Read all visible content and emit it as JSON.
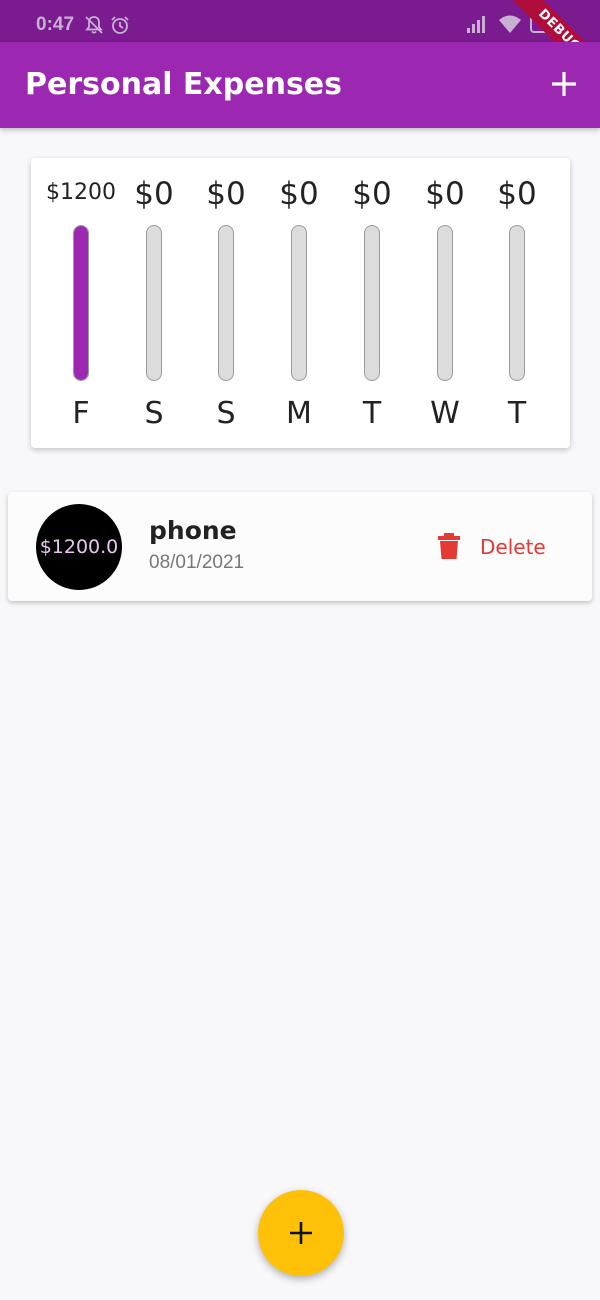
{
  "status_bar": {
    "time": "0:47",
    "icons": [
      "notifications-off-icon",
      "alarm-icon",
      "signal-icon",
      "wifi-icon",
      "battery-icon"
    ],
    "battery_level": "40"
  },
  "debug_banner": "DEBUG",
  "app_bar": {
    "title": "Personal Expenses",
    "action_icon": "add-icon",
    "background": "#9c27b0"
  },
  "chart": {
    "bars": [
      {
        "day": "F",
        "amount": "$1200",
        "fill_fraction": 1.0
      },
      {
        "day": "S",
        "amount": "$0",
        "fill_fraction": 0
      },
      {
        "day": "S",
        "amount": "$0",
        "fill_fraction": 0
      },
      {
        "day": "M",
        "amount": "$0",
        "fill_fraction": 0
      },
      {
        "day": "T",
        "amount": "$0",
        "fill_fraction": 0
      },
      {
        "day": "W",
        "amount": "$0",
        "fill_fraction": 0
      },
      {
        "day": "T",
        "amount": "$0",
        "fill_fraction": 0
      }
    ],
    "bar_color": "#9c27b0",
    "track_color": "#dcdcdc"
  },
  "transactions": [
    {
      "amount": "$1200.0",
      "title": "phone",
      "date": "08/01/2021",
      "delete_label": "Delete",
      "delete_icon": "trash-icon"
    }
  ],
  "fab": {
    "icon": "add-icon",
    "color": "#ffc107"
  }
}
